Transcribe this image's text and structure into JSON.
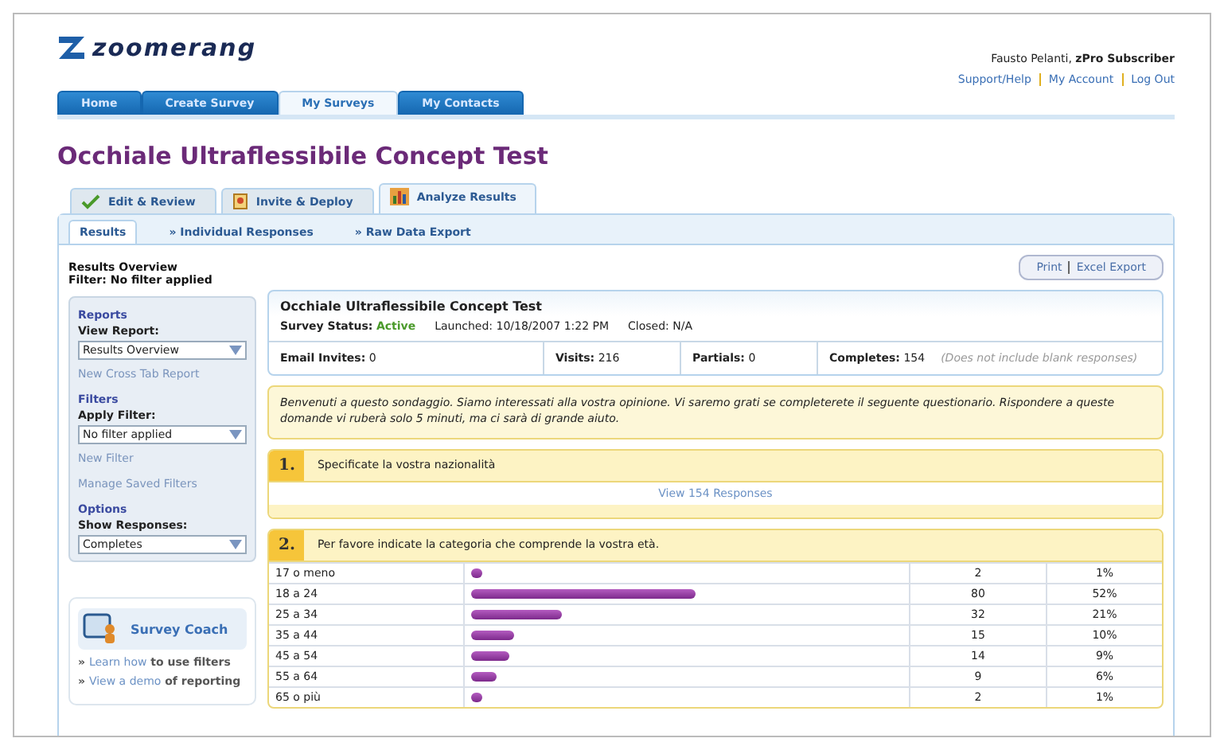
{
  "header": {
    "logo": "zoomerang",
    "user": "Fausto Pelanti, **zPro Subscriber**",
    "links": [
      "Support/Help",
      "My Account",
      "Log Out"
    ]
  },
  "nav_tabs": [
    {
      "label": "Home",
      "selected": false
    },
    {
      "label": "Create Survey",
      "selected": false
    },
    {
      "label": "My Surveys",
      "selected": true
    },
    {
      "label": "My Contacts",
      "selected": false
    }
  ],
  "page_title": "Occhiale Ultraflessibile Concept Test",
  "section_tabs": [
    {
      "label": "Edit & Review",
      "selected": false,
      "kind": "check"
    },
    {
      "label": "Invite & Deploy",
      "selected": false,
      "kind": "deploy"
    },
    {
      "label": "Analyze Results",
      "selected": true,
      "kind": "chart"
    }
  ],
  "sub_tabs": [
    {
      "label": "Results",
      "selected": true
    },
    {
      "label": "» Individual Responses",
      "selected": false
    },
    {
      "label": "» Raw Data Export",
      "selected": false
    }
  ],
  "overview": {
    "title": "Results Overview",
    "filter": "Filter: No filter applied"
  },
  "actions": [
    "Print",
    "Excel Export"
  ],
  "sidebar": [
    {
      "kind": "heading",
      "text": "Reports"
    },
    {
      "kind": "label",
      "text": "View Report:"
    },
    {
      "kind": "select",
      "text": "Results Overview"
    },
    {
      "kind": "link",
      "text": "New Cross Tab Report"
    },
    {
      "kind": "heading",
      "text": "Filters"
    },
    {
      "kind": "label",
      "text": "Apply Filter:"
    },
    {
      "kind": "select",
      "text": "No filter applied"
    },
    {
      "kind": "link",
      "text": "New Filter"
    },
    {
      "kind": "link",
      "text": "Manage Saved Filters"
    },
    {
      "kind": "heading",
      "text": "Options"
    },
    {
      "kind": "label",
      "text": "Show Responses:"
    },
    {
      "kind": "select",
      "text": "Completes"
    }
  ],
  "coach": {
    "title": "Survey Coach",
    "tips": [
      {
        "bullet": "»",
        "link": "Learn how",
        "text": "to use filters"
      },
      {
        "bullet": "»",
        "link": "View a demo",
        "text": "of reporting"
      }
    ]
  },
  "summary": {
    "title": "Occhiale Ultraflessibile Concept Test",
    "status_label": "Survey Status:",
    "status": "Active",
    "launched": "Launched: 10/18/2007 1:22 PM",
    "closed": "Closed: N/A",
    "stats": [
      {
        "label": "Email Invites:",
        "value": "0"
      },
      {
        "label": "Visits:",
        "value": "216"
      },
      {
        "label": "Partials:",
        "value": "0"
      },
      {
        "label": "Completes:",
        "value": "154",
        "note": "(Does not include blank responses)"
      }
    ]
  },
  "intro": "Benvenuti a questo sondaggio. Siamo interessati alla vostra opinione. Vi saremo grati se completerete il seguente questionario. Rispondere a queste domande vi ruberà solo 5 minuti, ma ci sarà di grande aiuto.",
  "questions": [
    {
      "kind": "open",
      "number": "1.",
      "text": "Specificate la vostra nazionalità",
      "link": "View 154 Responses"
    },
    {
      "kind": "choice",
      "number": "2.",
      "text": "Per favore indicate la categoria che comprende la vostra età.",
      "rows": [
        {
          "label": "17 o meno",
          "count": "2",
          "percent": "1%",
          "level": 0.01
        },
        {
          "label": "18 a 24",
          "count": "80",
          "percent": "52%",
          "level": 0.52
        },
        {
          "label": "25 a 34",
          "count": "32",
          "percent": "21%",
          "level": 0.21
        },
        {
          "label": "35 a 44",
          "count": "15",
          "percent": "10%",
          "level": 0.1
        },
        {
          "label": "45 a 54",
          "count": "14",
          "percent": "9%",
          "level": 0.09
        },
        {
          "label": "55 a 64",
          "count": "9",
          "percent": "6%",
          "level": 0.06
        },
        {
          "label": "65 o più",
          "count": "2",
          "percent": "1%",
          "level": 0.01
        }
      ]
    }
  ]
}
